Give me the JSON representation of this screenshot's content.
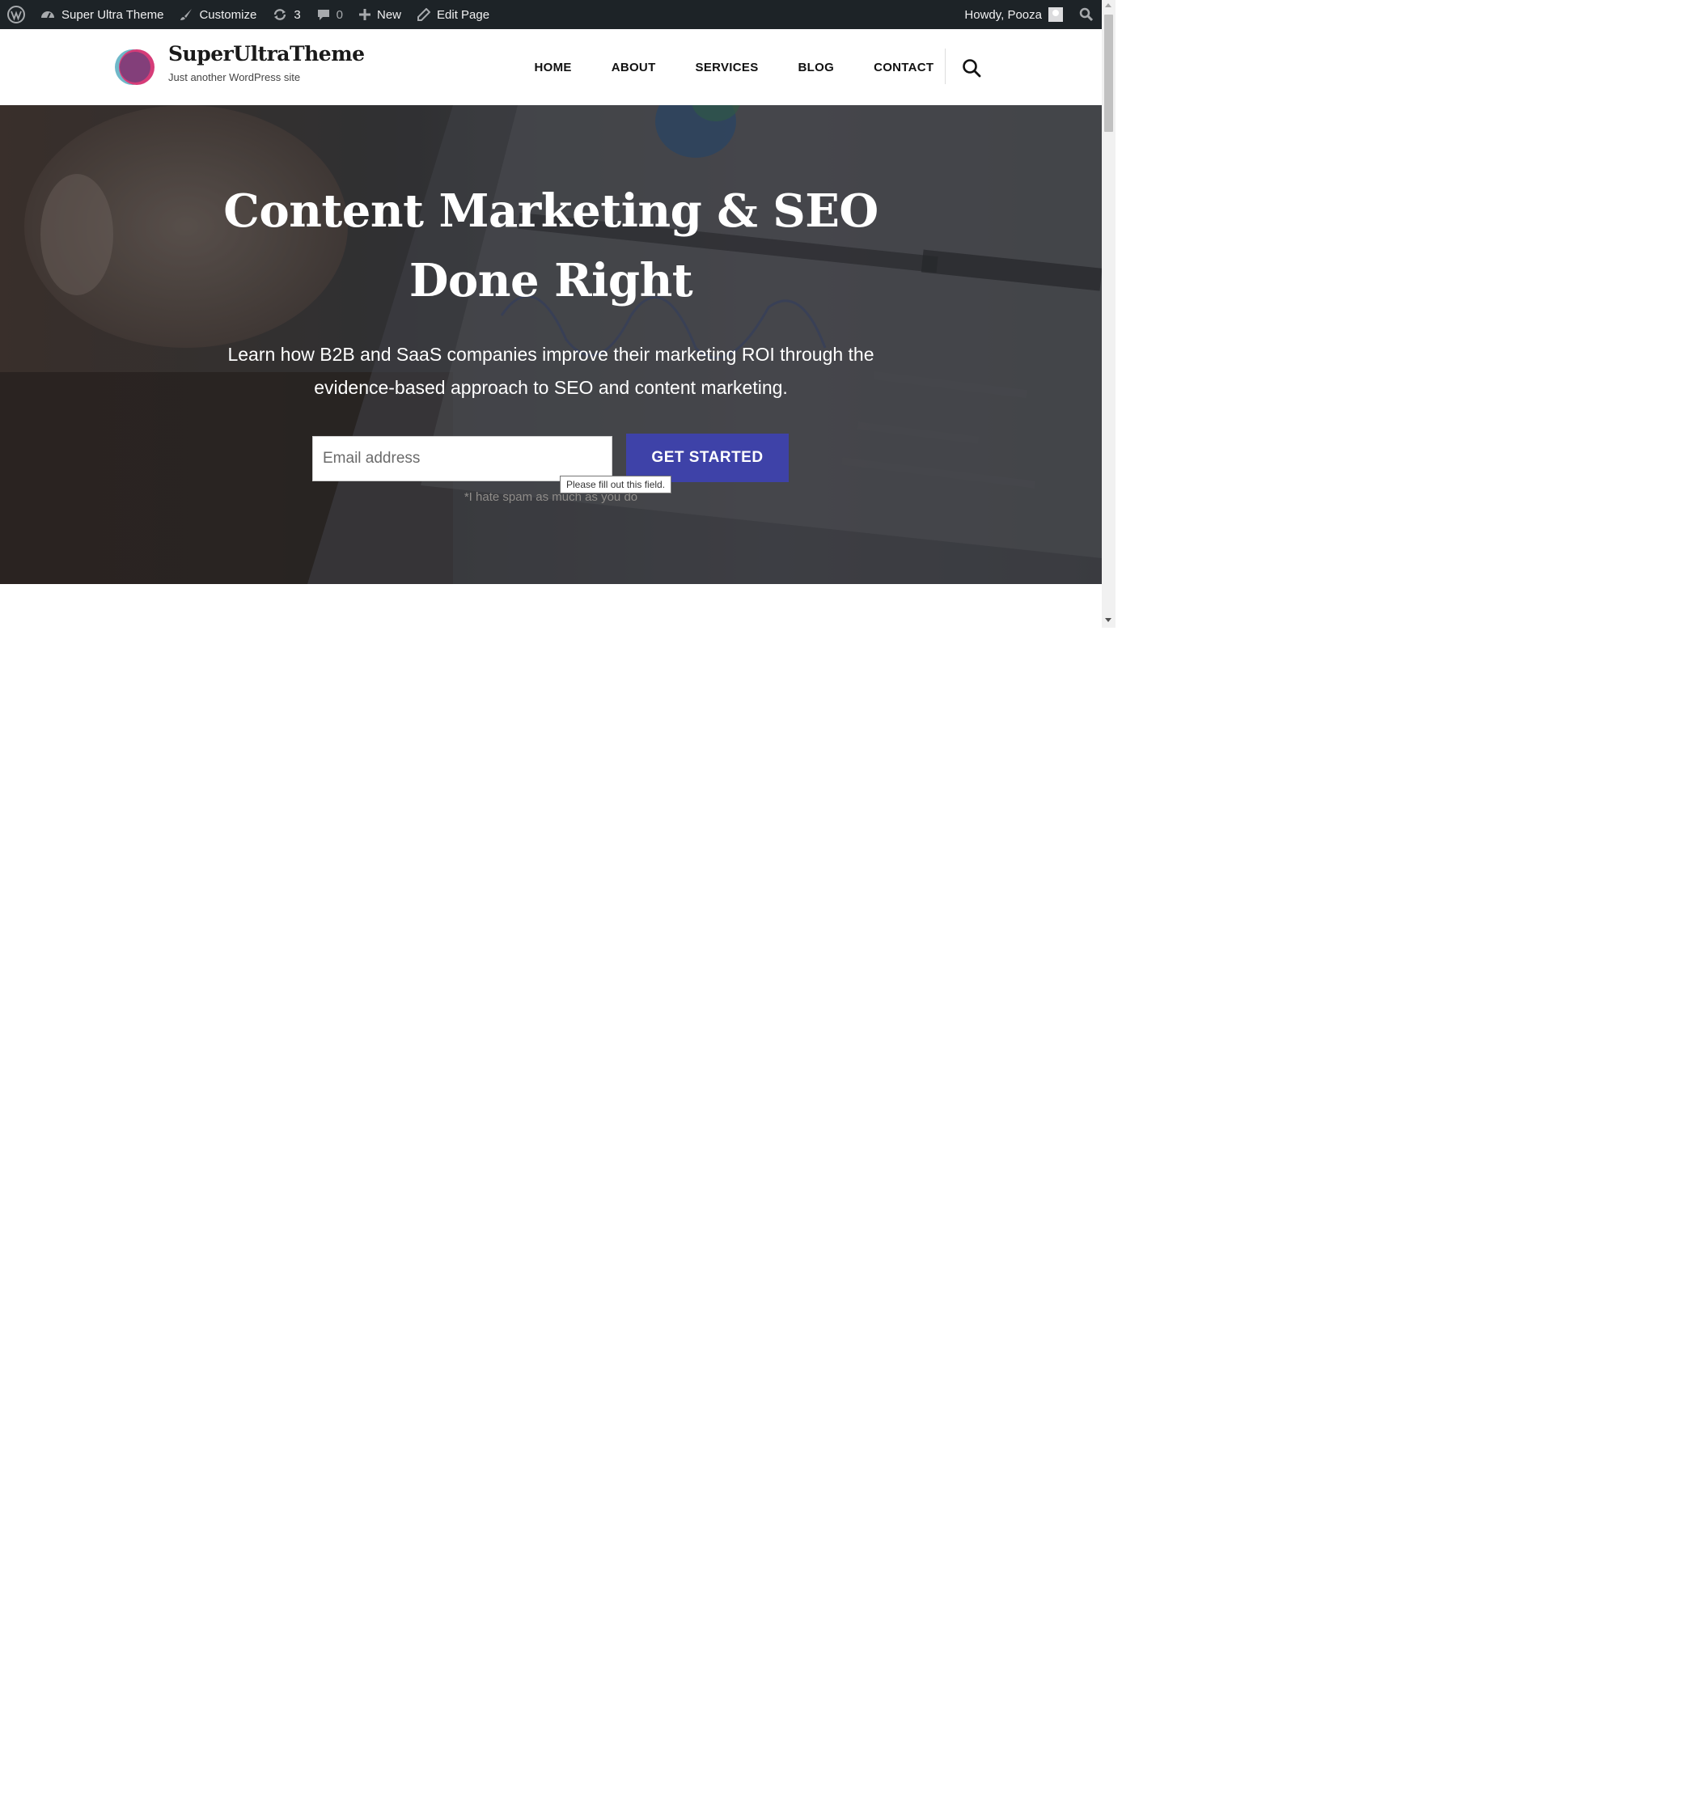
{
  "admin_bar": {
    "site_name": "Super Ultra Theme",
    "customize": "Customize",
    "updates_count": "3",
    "comments_count": "0",
    "new": "New",
    "edit_page": "Edit Page",
    "howdy": "Howdy, Pooza"
  },
  "header": {
    "site_title": "SuperUltraTheme",
    "tagline": "Just another WordPress site",
    "nav": [
      "HOME",
      "ABOUT",
      "SERVICES",
      "BLOG",
      "CONTACT"
    ]
  },
  "hero": {
    "title_line1": "Content Marketing & SEO",
    "title_line2": "Done Right",
    "subtitle_line1": "Learn how B2B and SaaS companies improve their marketing ROI through the",
    "subtitle_line2": "evidence-based approach to SEO and content marketing.",
    "email_placeholder": "Email address",
    "cta_label": "GET STARTED",
    "spam_note": "*I hate spam as much as you do",
    "validation_tooltip": "Please fill out this field."
  },
  "colors": {
    "admin_bar_bg": "#1d2327",
    "cta_bg": "#3e42a8",
    "logo_pink": "#d63c78",
    "logo_teal": "#6fb8c9",
    "logo_purple": "#7a3f7a"
  },
  "icons": {
    "admin_bar": [
      "wordpress-logo-icon",
      "dashboard-icon",
      "brush-icon",
      "update-icon",
      "comment-icon",
      "plus-icon",
      "pencil-icon",
      "avatar-icon",
      "search-icon"
    ],
    "header": [
      "site-logo-icon",
      "search-icon"
    ]
  }
}
